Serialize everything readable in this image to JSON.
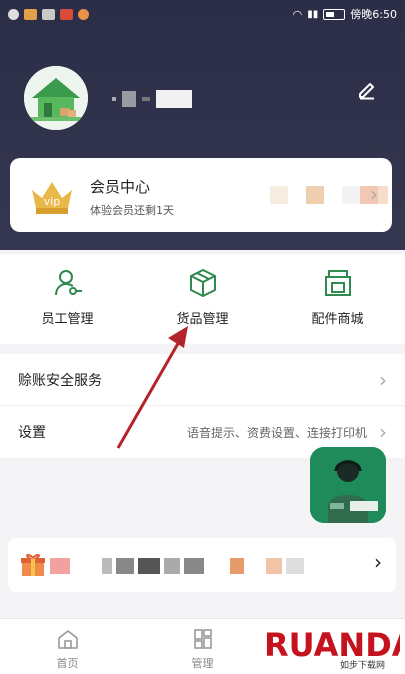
{
  "status_bar": {
    "time": "傍晚6:50"
  },
  "profile": {
    "edit_icon": "pencil-icon"
  },
  "member_card": {
    "title": "会员中心",
    "subtitle": "体验会员还剩1天",
    "badge_text": "vip"
  },
  "tools": [
    {
      "label": "员工管理",
      "icon": "staff-icon"
    },
    {
      "label": "货品管理",
      "icon": "box-icon"
    },
    {
      "label": "配件商城",
      "icon": "shop-icon"
    }
  ],
  "settings": [
    {
      "label": "赊账安全服务",
      "desc": ""
    },
    {
      "label": "设置",
      "desc": "语音提示、资费设置、连接打印机"
    }
  ],
  "bottom_nav": [
    {
      "label": "首页",
      "icon": "home-icon"
    },
    {
      "label": "管理",
      "icon": "manage-icon"
    }
  ],
  "watermark": {
    "brand": "RUANDAO",
    "sub": "如步下载网"
  },
  "colors": {
    "header_bg": "#2c2e48",
    "accent_green": "#2e8a4e",
    "annotation_red": "#b5232a"
  }
}
